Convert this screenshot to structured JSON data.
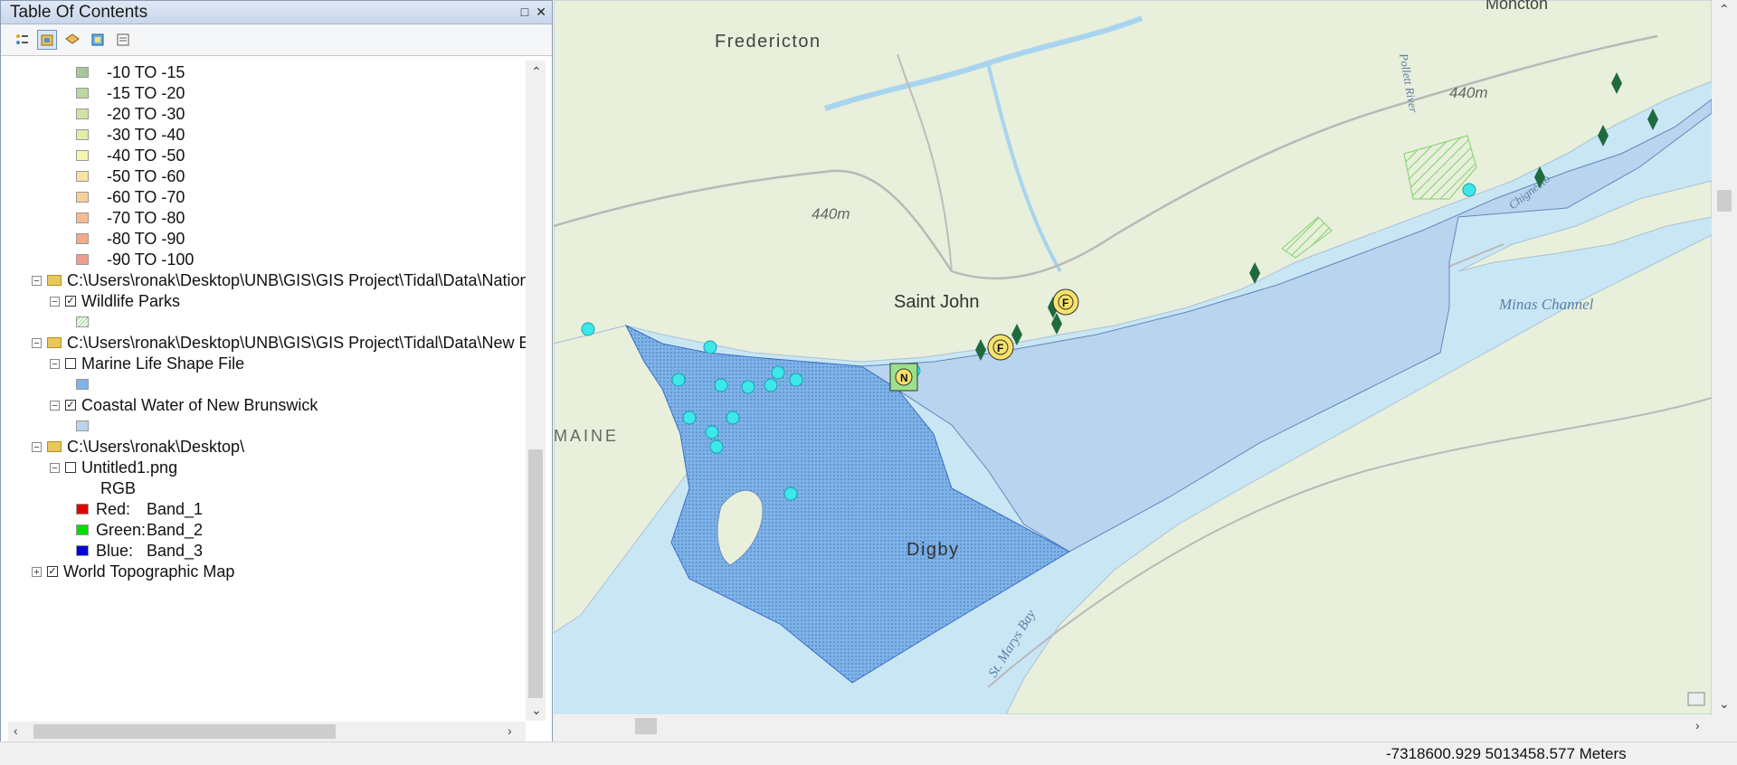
{
  "toc": {
    "title": "Table Of Contents",
    "legend_entries": [
      {
        "label": "-10 TO   -15",
        "color": "#a6c79a"
      },
      {
        "label": "-15 TO   -20",
        "color": "#bcd79f"
      },
      {
        "label": "-20 TO   -30",
        "color": "#cfe3a4"
      },
      {
        "label": "-30 TO   -40",
        "color": "#e2eca8"
      },
      {
        "label": "-40 TO   -50",
        "color": "#f6f6ab"
      },
      {
        "label": "-50 TO   -60",
        "color": "#fae3a2"
      },
      {
        "label": "-60 TO   -70",
        "color": "#f9d098"
      },
      {
        "label": "-70 TO   -80",
        "color": "#f7bb90"
      },
      {
        "label": "-80 TO   -90",
        "color": "#f3a98b"
      },
      {
        "label": "-90 TO  -100",
        "color": "#f29b8f"
      }
    ],
    "groups": {
      "group1_path": "C:\\Users\\ronak\\Desktop\\UNB\\GIS\\GIS Project\\Tidal\\Data\\Nation",
      "wildlife_parks": "Wildlife Parks",
      "group2_path": "C:\\Users\\ronak\\Desktop\\UNB\\GIS\\GIS Project\\Tidal\\Data\\New B",
      "marine_life": "Marine Life Shape File",
      "coastal_water": "Coastal Water of New Brunswick",
      "group3_path": "C:\\Users\\ronak\\Desktop\\",
      "untitled_png": "Untitled1.png",
      "rgb": "RGB",
      "red_label": "Red:",
      "red_band": "Band_1",
      "green_label": "Green:",
      "green_band": "Band_2",
      "blue_label": "Blue:",
      "blue_band": "Band_3",
      "world_topo": "World Topographic Map"
    }
  },
  "map": {
    "labels": {
      "fredericton": "Fredericton",
      "moncton": "Moncton",
      "saint_john": "Saint John",
      "digby": "Digby",
      "maine": "MAINE",
      "minas_channel": "Minas Channel",
      "st_marys_bay": "St. Marys Bay",
      "elev1": "440m",
      "elev2": "440m",
      "pollett_river": "Pollett River",
      "chignecto": "Chignecto"
    }
  },
  "status": {
    "coordinates": "-7318600.929  5013458.577 Meters"
  },
  "colors": {
    "land": "#e9efdc",
    "water": "#c9e6f5",
    "coastal_polygon": "#b9d4ee",
    "marine_polygon": "#80b4e8",
    "marker_diamond": "#1f6b3f",
    "marker_cyan": "#3ce8e8",
    "marker_f": "#f7e26b"
  }
}
